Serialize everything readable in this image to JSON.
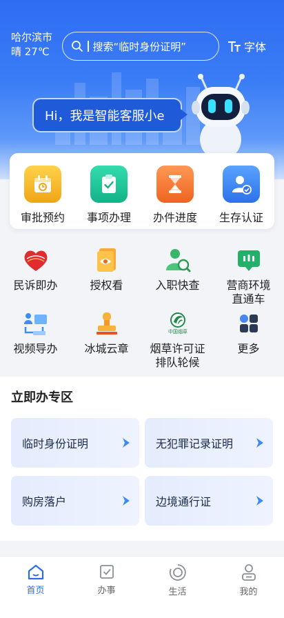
{
  "header": {
    "city": "哈尔滨市",
    "weather": "晴 27℃",
    "search_placeholder": "搜索“临时身份证明”",
    "font_label": "字体"
  },
  "assistant": {
    "greeting": "Hi，我是智能客服小e"
  },
  "quick_actions": [
    {
      "label": "审批预约",
      "icon": "calendar-icon",
      "color": "#f5b62a"
    },
    {
      "label": "事项办理",
      "icon": "clipboard-check-icon",
      "color": "#1fc59a"
    },
    {
      "label": "办件进度",
      "icon": "hourglass-icon",
      "color": "#f27a3a"
    },
    {
      "label": "生存认证",
      "icon": "user-verified-icon",
      "color": "#3a83f1"
    }
  ],
  "services": [
    {
      "label": "民诉即办",
      "icon": "12345-hotline-icon"
    },
    {
      "label": "授权看",
      "icon": "eye-document-icon"
    },
    {
      "label": "入职快查",
      "icon": "person-search-icon"
    },
    {
      "label": "营商环境直通车",
      "label_lines": [
        "营商环境",
        "直通车"
      ],
      "icon": "chat-bubble-icon"
    },
    {
      "label": "视频导办",
      "icon": "video-guide-icon"
    },
    {
      "label": "冰城云章",
      "icon": "seal-stamp-icon"
    },
    {
      "label": "烟草许可证排队轮候",
      "label_lines": [
        "烟草许可证",
        "排队轮候"
      ],
      "icon": "china-tobacco-logo-icon",
      "logo_text": "中国烟草"
    },
    {
      "label": "更多",
      "icon": "more-grid-icon"
    }
  ],
  "zone": {
    "title": "立即办专区",
    "items": [
      "临时身份证明",
      "无犯罪记录证明",
      "购房落户",
      "边境通行证"
    ]
  },
  "tabs": [
    {
      "label": "首页",
      "icon": "home-icon",
      "active": true
    },
    {
      "label": "办事",
      "icon": "checkbox-icon",
      "active": false
    },
    {
      "label": "生活",
      "icon": "life-ring-icon",
      "active": false
    },
    {
      "label": "我的",
      "icon": "profile-icon",
      "active": false
    }
  ],
  "colors": {
    "primary": "#2a6cf2",
    "hero_top": "#2f6df3",
    "tile_bg": "#e4ecfd",
    "arrow": "#3d8bf0"
  }
}
